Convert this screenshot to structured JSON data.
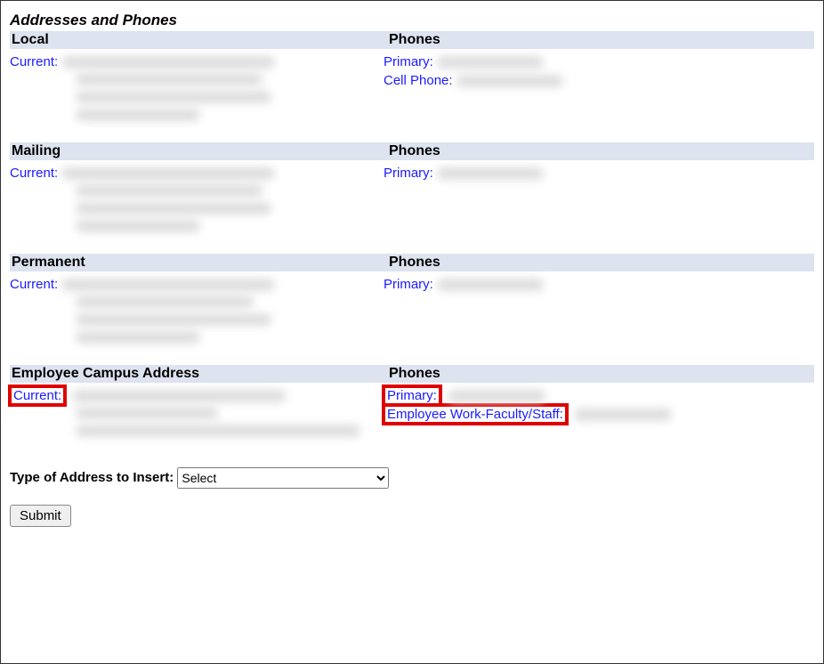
{
  "title": "Addresses and Phones",
  "sections": {
    "local": {
      "address_header": "Local",
      "phones_header": "Phones",
      "current_label": "Current:",
      "phones": {
        "primary_label": "Primary:",
        "cell_label": "Cell Phone:"
      }
    },
    "mailing": {
      "address_header": "Mailing",
      "phones_header": "Phones",
      "current_label": "Current:",
      "phones": {
        "primary_label": "Primary:"
      }
    },
    "permanent": {
      "address_header": "Permanent",
      "phones_header": "Phones",
      "current_label": "Current:",
      "phones": {
        "primary_label": "Primary:"
      }
    },
    "employee": {
      "address_header": "Employee Campus Address",
      "phones_header": "Phones",
      "current_label": "Current:",
      "phones": {
        "primary_label": "Primary:",
        "work_label": "Employee Work-Faculty/Staff:"
      }
    }
  },
  "insert_label": "Type of Address to Insert:",
  "insert_selected": "Select",
  "submit_label": "Submit"
}
